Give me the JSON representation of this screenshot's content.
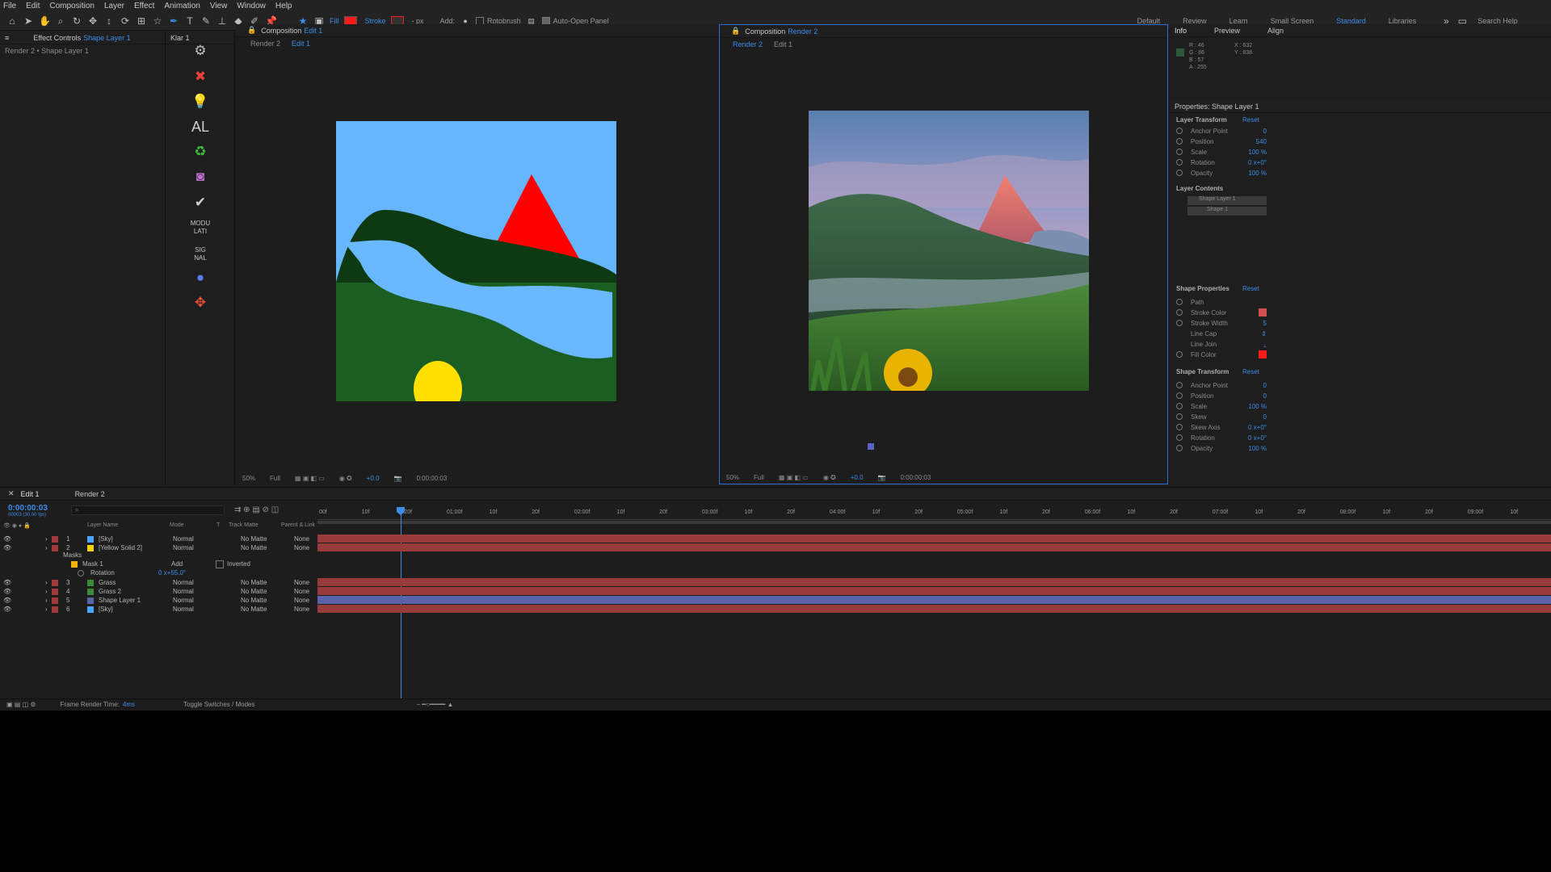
{
  "menu": [
    "File",
    "Edit",
    "Composition",
    "Layer",
    "Effect",
    "Animation",
    "View",
    "Window",
    "Help"
  ],
  "toolbar": {
    "fill_label": "Fill",
    "stroke_label": "Stroke",
    "px": "- px",
    "add": "Add:",
    "rotobrush": "Rotobrush",
    "auto_open": "Auto-Open Panel",
    "fill_color": "#ff1a1a",
    "stroke_color": "#ff1a1a",
    "workspaces": [
      "Default",
      "Review",
      "Learn",
      "Small Screen",
      "Standard",
      "Libraries"
    ],
    "active_workspace": "Standard",
    "search_placeholder": "Search Help"
  },
  "effects_panel": {
    "tab": "Effect Controls",
    "tab_layer": "Shape Layer 1",
    "breadcrumb": "Render 2 • Shape Layer 1"
  },
  "klar": {
    "tab": "Klar 1",
    "al": "AL",
    "mod": "MODU LATI",
    "sig": "SIG NAL"
  },
  "comp1": {
    "tab": "Composition",
    "tab_name": "Edit 1",
    "crumbs": [
      "Render 2",
      "Edit 1"
    ],
    "zoom": "50%",
    "quality": "Full",
    "exposure": "+0.0",
    "time": "0:00:00:03",
    "colors": {
      "sky": "#66b5ff",
      "hill": "#0d3a12",
      "grass": "#1b5e22",
      "water": "#6ab8ff",
      "mountain": "#ff0000",
      "sun": "#ffe000"
    }
  },
  "comp2": {
    "tab": "Composition",
    "tab_name": "Render 2",
    "crumbs": [
      "Render 2",
      "Edit 1"
    ],
    "zoom": "50%",
    "quality": "Full",
    "exposure": "+0.0",
    "time": "0:00:00:03"
  },
  "info": {
    "tabs": [
      "Info",
      "Preview",
      "Align"
    ],
    "rgb": [
      "R : 46",
      "G : 86",
      "B : 57",
      "A : 255"
    ],
    "coords": [
      "X : 632",
      "Y : 838"
    ]
  },
  "properties": {
    "title": "Properties: Shape Layer 1",
    "layer_transform": {
      "title": "Layer Transform",
      "reset": "Reset",
      "rows": [
        {
          "label": "Anchor Point",
          "value": "0"
        },
        {
          "label": "Position",
          "value": "540"
        },
        {
          "label": "Scale",
          "value": "100 %"
        },
        {
          "label": "Rotation",
          "value": "0 x+0°"
        },
        {
          "label": "Opacity",
          "value": "100 %"
        }
      ]
    },
    "layer_contents": {
      "title": "Layer Contents",
      "items": [
        "Shape Layer 1",
        "Shape 1"
      ]
    },
    "shape_properties": {
      "title": "Shape Properties",
      "reset": "Reset",
      "rows": [
        {
          "label": "Path",
          "value": ""
        },
        {
          "label": "Stroke Color",
          "value": ""
        },
        {
          "label": "Stroke Width",
          "value": "5"
        },
        {
          "label": "Line Cap",
          "value": ""
        },
        {
          "label": "Line Join",
          "value": ""
        },
        {
          "label": "Fill Color",
          "value": ""
        }
      ]
    },
    "shape_transform": {
      "title": "Shape Transform",
      "reset": "Reset",
      "rows": [
        {
          "label": "Anchor Point",
          "value": "0"
        },
        {
          "label": "Position",
          "value": "0"
        },
        {
          "label": "Scale",
          "value": "100 %"
        },
        {
          "label": "Skew",
          "value": "0"
        },
        {
          "label": "Skew Axis",
          "value": "0 x+0°"
        },
        {
          "label": "Rotation",
          "value": "0 x+0°"
        },
        {
          "label": "Opacity",
          "value": "100 %"
        }
      ]
    }
  },
  "timeline": {
    "tabs": [
      "Edit 1",
      "Render 2"
    ],
    "timecode": "0:00:00:03",
    "fps": "00003 (30.00 fps)",
    "search_placeholder": "",
    "columns": [
      "Layer Name",
      "Mode",
      "T",
      "Track Matte",
      "Parent & Link"
    ],
    "ruler": [
      "00f",
      "10f",
      "20f",
      "01:00f",
      "10f",
      "20f",
      "02:00f",
      "10f",
      "20f",
      "03:00f",
      "10f",
      "20f",
      "04:00f",
      "10f",
      "20f",
      "05:00f",
      "10f",
      "20f",
      "06:00f",
      "10f",
      "20f",
      "07:00f",
      "10f",
      "20f",
      "08:00f",
      "10f",
      "20f",
      "09:00f",
      "10f"
    ],
    "layers": [
      {
        "num": "1",
        "name": "[Sky]",
        "mode": "Normal",
        "matte": "No Matte",
        "parent": "None",
        "color": "#4aa3ff"
      },
      {
        "num": "2",
        "name": "[Yellow Solid 2]",
        "mode": "Normal",
        "matte": "No Matte",
        "parent": "None",
        "color": "#f5d400"
      },
      {
        "num": "3",
        "name": "Grass",
        "mode": "Normal",
        "matte": "No Matte",
        "parent": "None",
        "color": "#3a8a3a"
      },
      {
        "num": "4",
        "name": "Grass 2",
        "mode": "Normal",
        "matte": "No Matte",
        "parent": "None",
        "color": "#3a8a3a"
      },
      {
        "num": "5",
        "name": "Shape Layer 1",
        "mode": "Normal",
        "matte": "No Matte",
        "parent": "None",
        "color": "#5a62a8"
      },
      {
        "num": "6",
        "name": "[Sky]",
        "mode": "Normal",
        "matte": "No Matte",
        "parent": "None",
        "color": "#4aa3ff"
      }
    ],
    "masks_label": "Masks",
    "mask1": "Mask 1",
    "mask_mode": "Add",
    "inverted": "Inverted",
    "rotation_label": "Rotation",
    "rotation_value": "0 x+55.0°"
  },
  "status": {
    "frame_render_label": "Frame Render Time:",
    "frame_render_value": "4ms",
    "toggle": "Toggle Switches / Modes"
  }
}
